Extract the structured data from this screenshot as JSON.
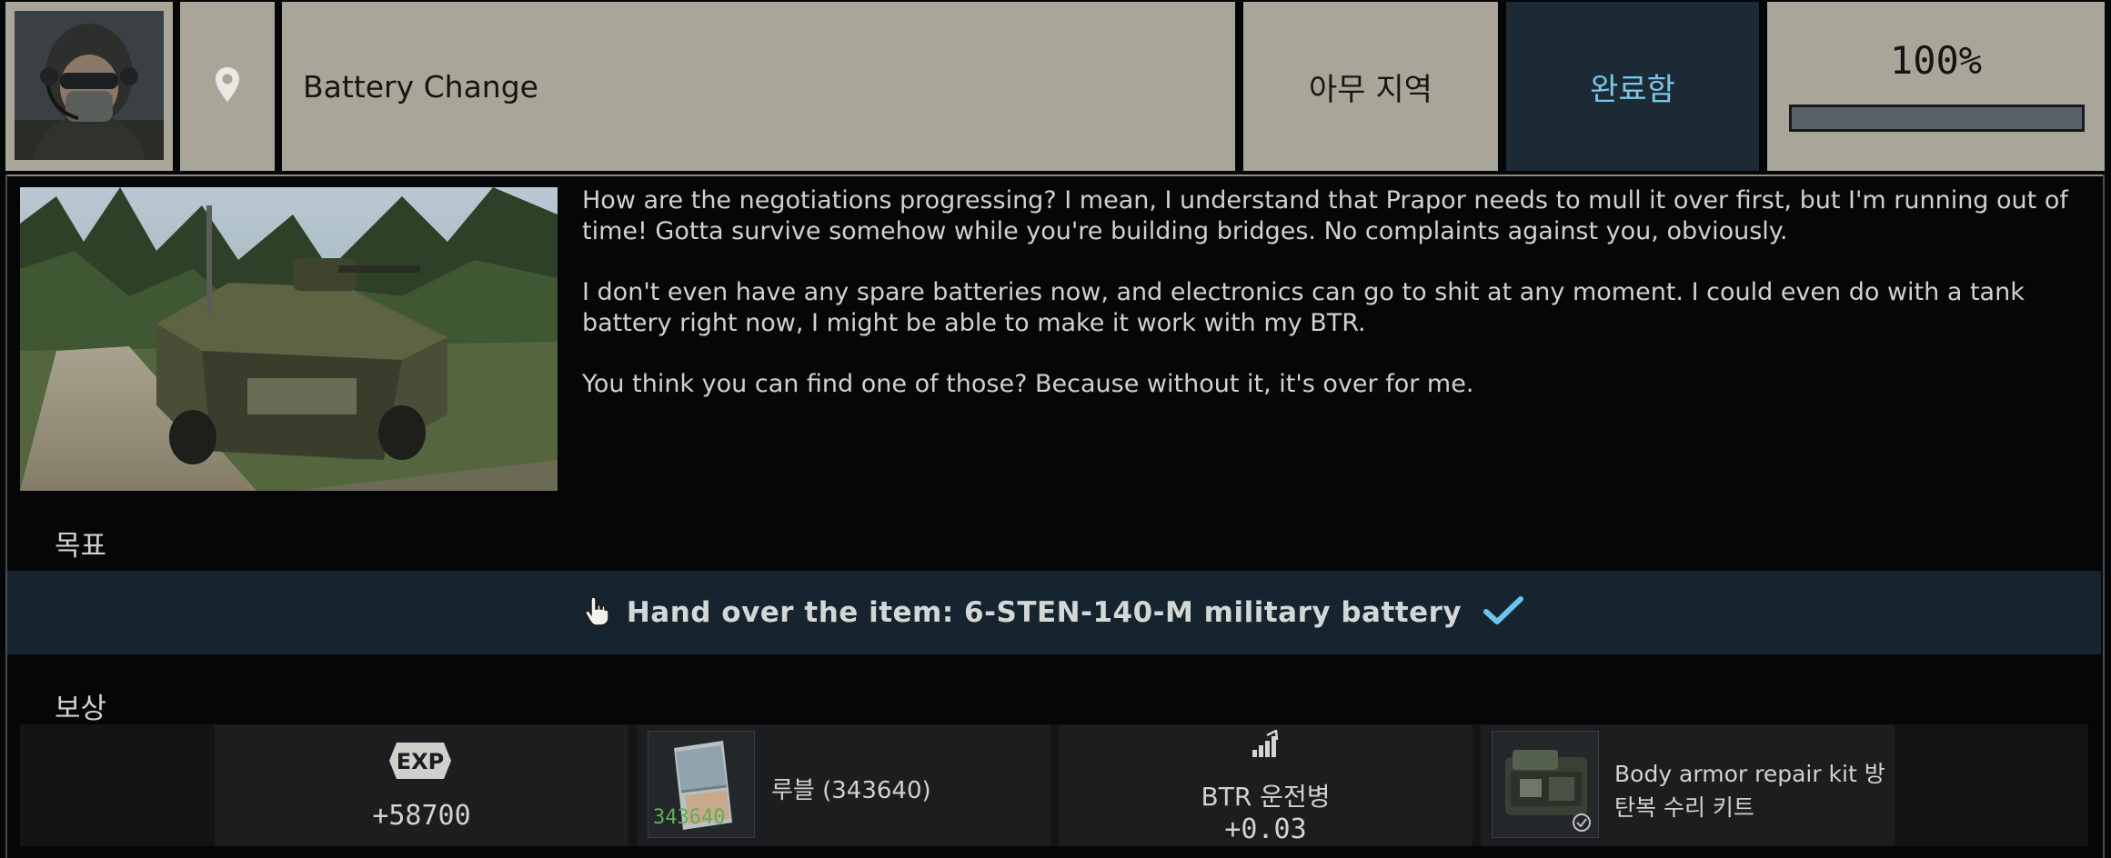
{
  "quest": {
    "title": "Battery Change",
    "location": "아무 지역",
    "status": "완료함",
    "progress_text": "100%",
    "progress_fraction": 1.0
  },
  "description": [
    "How are the negotiations progressing? I mean, I understand that Prapor needs to mull it over first, but I'm running out of time! Gotta survive somehow while you're building bridges. No complaints against you, obviously.",
    "I don't even have any spare batteries now, and electronics can go to shit at any moment. I could even do with a tank battery right now, I might be able to make it work with my BTR.",
    "You think you can find one of those? Because without it, it's over for me."
  ],
  "objectives": {
    "label": "목표",
    "items": [
      {
        "text": "Hand over the item: 6-STEN-140-M military battery",
        "completed": true
      }
    ]
  },
  "rewards": {
    "label": "보상",
    "exp": {
      "badge": "EXP",
      "value": "+58700"
    },
    "roubles": {
      "icon_amount": "343640",
      "label": "루블 (343640)"
    },
    "skill": {
      "name": "BTR 운전병",
      "value": "+0.03"
    },
    "item": {
      "name_line1": "Body armor repair kit 방",
      "name_line2": "탄복 수리 키트"
    }
  },
  "colors": {
    "header_bg": "#a9a699",
    "status_bg": "#1c2a36",
    "status_text": "#7ec3e8",
    "objective_band": "#162430",
    "check_accent": "#6cc3ee",
    "rouble_green": "#5fae57"
  },
  "icons": [
    "location-pin-icon",
    "hand-pointer-icon",
    "checkmark-icon",
    "exp-icon",
    "rouble-icon",
    "skill-up-icon",
    "repair-kit-icon"
  ]
}
